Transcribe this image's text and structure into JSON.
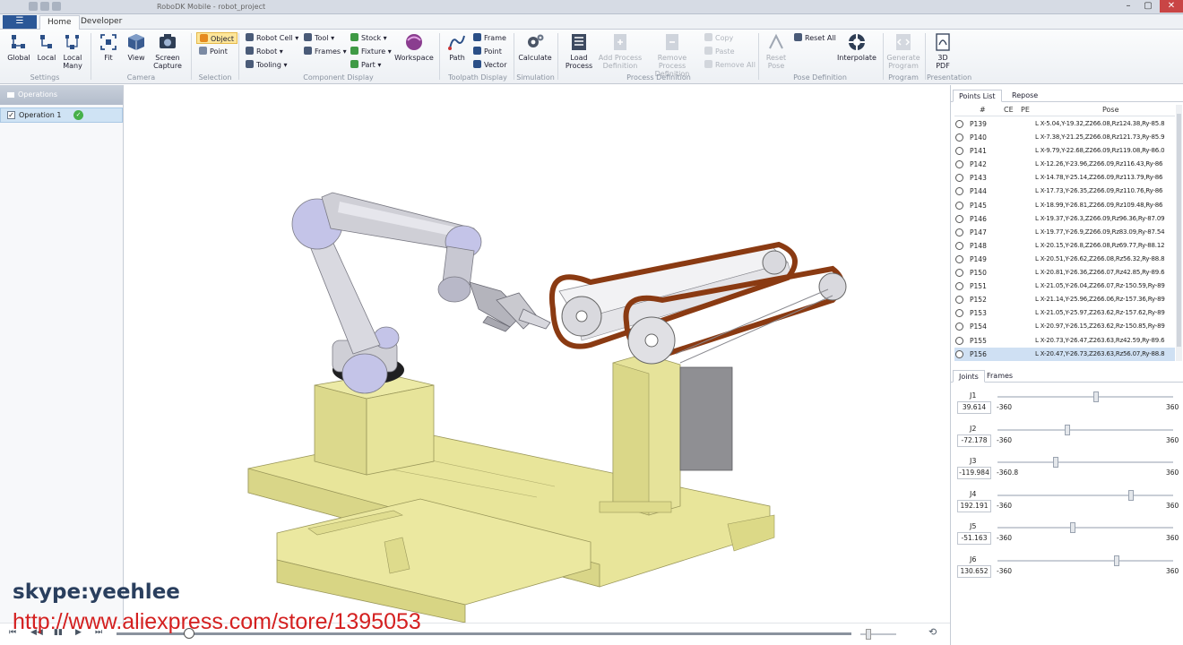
{
  "window": {
    "title": "RoboDK Mobile - robot_project",
    "controls": [
      "–",
      "▢",
      "✕"
    ]
  },
  "menu": {
    "app_button": "☰",
    "tabs": [
      "Home",
      "Developer"
    ]
  },
  "ribbon": {
    "settings": {
      "global": "Global",
      "local": "Local",
      "local_many": "Local Many",
      "label": "Settings"
    },
    "camera": {
      "fit": "Fit",
      "view": "View",
      "screen_capture": "Screen Capture",
      "label": "Camera"
    },
    "selection": {
      "object": "Object",
      "point": "Point",
      "label": "Selection"
    },
    "component_display": {
      "robot_cell": "Robot Cell",
      "robot": "Robot",
      "tooling": "Tooling",
      "tool": "Tool",
      "frames": "Frames",
      "stock": "Stock",
      "fixture": "Fixture",
      "part": "Part",
      "workspace": "Workspace",
      "label": "Component Display"
    },
    "toolpath_display": {
      "path": "Path",
      "frame": "Frame",
      "point": "Point",
      "vector": "Vector",
      "label": "Toolpath Display"
    },
    "simulation": {
      "calculate": "Calculate",
      "label": "Simulation"
    },
    "process_definition": {
      "load_process": "Load Process",
      "add_process_definition": "Add Process Definition",
      "remove_process_definition": "Remove Process Definition",
      "copy": "Copy",
      "paste": "Paste",
      "remove_all": "Remove All",
      "label": "Process Definition"
    },
    "pose_definition": {
      "reset_pose": "Reset Pose",
      "reset_all": "Reset All",
      "interpolate": "Interpolate",
      "label": "Pose Definition"
    },
    "program": {
      "generate_program": "Generate Program",
      "label": "Program"
    },
    "presentation": {
      "pdf_3d": "3D PDF",
      "label": "Presentation"
    }
  },
  "operations": {
    "header": "Operations",
    "items": [
      {
        "label": "Operation 1",
        "checked": "✓",
        "status": "✓"
      }
    ]
  },
  "points_panel": {
    "tabs": [
      "Points List",
      "Repose"
    ],
    "columns": [
      "#",
      "CE",
      "PE",
      "Pose"
    ],
    "rows": [
      {
        "id": "P139",
        "pose": "L X-5.04,Y-19.32,Z266.08,Rz124.38,Ry-85.8"
      },
      {
        "id": "P140",
        "pose": "L X-7.38,Y-21.25,Z266.08,Rz121.73,Ry-85.9"
      },
      {
        "id": "P141",
        "pose": "L X-9.79,Y-22.68,Z266.09,Rz119.08,Ry-86.0"
      },
      {
        "id": "P142",
        "pose": "L X-12.26,Y-23.96,Z266.09,Rz116.43,Ry-86"
      },
      {
        "id": "P143",
        "pose": "L X-14.78,Y-25.14,Z266.09,Rz113.79,Ry-86"
      },
      {
        "id": "P144",
        "pose": "L X-17.73,Y-26.35,Z266.09,Rz110.76,Ry-86"
      },
      {
        "id": "P145",
        "pose": "L X-18.99,Y-26.81,Z266.09,Rz109.48,Ry-86"
      },
      {
        "id": "P146",
        "pose": "L X-19.37,Y-26.3,Z266.09,Rz96.36,Ry-87.09"
      },
      {
        "id": "P147",
        "pose": "L X-19.77,Y-26.9,Z266.09,Rz83.09,Ry-87.54"
      },
      {
        "id": "P148",
        "pose": "L X-20.15,Y-26.8,Z266.08,Rz69.77,Ry-88.12"
      },
      {
        "id": "P149",
        "pose": "L X-20.51,Y-26.62,Z266.08,Rz56.32,Ry-88.8"
      },
      {
        "id": "P150",
        "pose": "L X-20.81,Y-26.36,Z266.07,Rz42.85,Ry-89.6"
      },
      {
        "id": "P151",
        "pose": "L X-21.05,Y-26.04,Z266.07,Rz-150.59,Ry-89"
      },
      {
        "id": "P152",
        "pose": "L X-21.14,Y-25.96,Z266.06,Rz-157.36,Ry-89"
      },
      {
        "id": "P153",
        "pose": "L X-21.05,Y-25.97,Z263.62,Rz-157.62,Ry-89"
      },
      {
        "id": "P154",
        "pose": "L X-20.97,Y-26.15,Z263.62,Rz-150.85,Ry-89"
      },
      {
        "id": "P155",
        "pose": "L X-20.73,Y-26.47,Z263.63,Rz42.59,Ry-89.6"
      },
      {
        "id": "P156",
        "pose": "L X-20.47,Y-26.73,Z263.63,Rz56.07,Ry-88.8"
      }
    ],
    "selected_index": 17
  },
  "joints_panel": {
    "tabs": [
      "Joints",
      "Frames"
    ],
    "joints": [
      {
        "name": "J1",
        "value": "39.614",
        "min": "-360",
        "max": "360",
        "fraction": 0.56
      },
      {
        "name": "J2",
        "value": "-72.178",
        "min": "-360",
        "max": "360",
        "fraction": 0.4
      },
      {
        "name": "J3",
        "value": "-119.984",
        "min": "-360.8",
        "max": "360",
        "fraction": 0.33
      },
      {
        "name": "J4",
        "value": "192.191",
        "min": "-360",
        "max": "360",
        "fraction": 0.76
      },
      {
        "name": "J5",
        "value": "-51.163",
        "min": "-360",
        "max": "360",
        "fraction": 0.43
      },
      {
        "name": "J6",
        "value": "130.652",
        "min": "-360",
        "max": "360",
        "fraction": 0.68
      }
    ]
  },
  "playback": {
    "buttons": [
      "⏮",
      "◀◀",
      "▮▮",
      "▶",
      "⏭"
    ],
    "loop_icon": "⟲"
  },
  "watermark": {
    "skype": "skype:yeehlee",
    "store": "http://www.aliexpress.com/store/1395053"
  },
  "colors": {
    "accent": "#2b5797",
    "selection": "#cfe0f3",
    "fixture": "#eae79b",
    "robot_link": "#cfd3dc",
    "belt": "#8a3a12"
  }
}
